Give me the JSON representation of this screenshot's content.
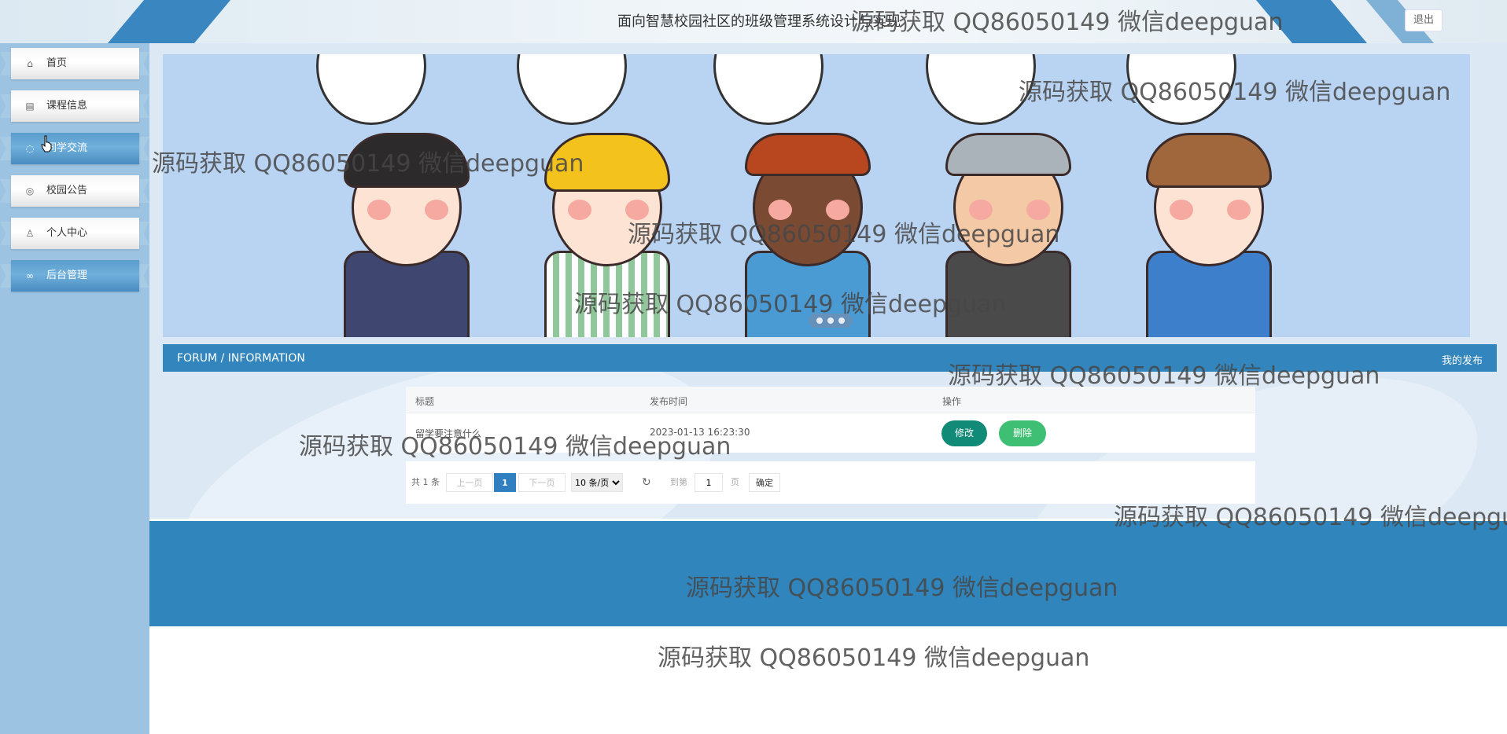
{
  "header": {
    "title": "面向智慧校园社区的班级管理系统设计与实现",
    "logout_label": "退出"
  },
  "sidebar": {
    "items": [
      {
        "label": "首页",
        "icon": "home-icon",
        "active": false
      },
      {
        "label": "课程信息",
        "icon": "document-icon",
        "active": false
      },
      {
        "label": "同学交流",
        "icon": "chat-icon",
        "active": true
      },
      {
        "label": "校园公告",
        "icon": "announcement-icon",
        "active": false
      },
      {
        "label": "个人中心",
        "icon": "user-icon",
        "active": false
      },
      {
        "label": "后台管理",
        "icon": "link-icon",
        "active": true
      }
    ]
  },
  "forum": {
    "section_title": "FORUM / INFORMATION",
    "my_posts_label": "我的发布",
    "columns": [
      "标题",
      "发布时间",
      "操作"
    ],
    "rows": [
      {
        "title": "留学要注意什么",
        "time": "2023-01-13 16:23:30",
        "edit_label": "修改",
        "delete_label": "删除"
      }
    ]
  },
  "pagination": {
    "total": "共 1 条",
    "prev": "上一页",
    "current": "1",
    "next": "下一页",
    "page_size": "10 条/页",
    "goto_label": "到第",
    "goto_value": "1",
    "page_suffix": "页",
    "confirm": "确定"
  },
  "watermark": "源码获取 QQ86050149 微信deepguan",
  "colors": {
    "primary": "#3286bd",
    "sidebar": "#9cc3e2",
    "edit_button": "#118a77",
    "delete_button": "#3fbf73"
  }
}
